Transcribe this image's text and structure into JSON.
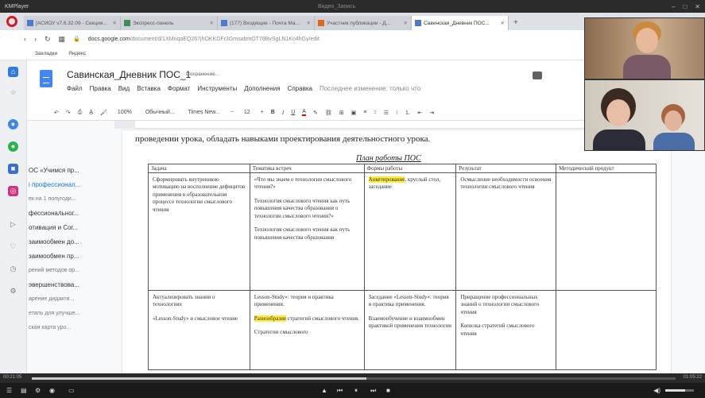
{
  "player": {
    "title": "KMPlayer",
    "window_title": "Видео_Запись",
    "time_elapsed": "00:21:05",
    "time_total": "01:05:22",
    "progress": 0.52,
    "volume": 0.7
  },
  "browser": {
    "tabs": [
      {
        "label": "[АСИОУ v7.6.32.09 - Секция..."
      },
      {
        "label": "Экспресс-панель"
      },
      {
        "label": "(177) Входящие - Почта Ма..."
      },
      {
        "label": "Участник публикации - Д..."
      },
      {
        "label": "Савинская_Дневник ПОС..."
      }
    ],
    "url_host": "docs.google.com",
    "url_path": "/document/d/1XMnqaEQ267jhOKKDFr3GmsabmOT78BvSgLN1Ko4hGy/edit",
    "bookmarks": [
      "Закладки",
      "Яндекс"
    ]
  },
  "doc": {
    "title": "Савинская_Дневник ПОС_1",
    "saving": "Сохранение...",
    "menu": [
      "Файл",
      "Правка",
      "Вид",
      "Вставка",
      "Формат",
      "Инструменты",
      "Дополнения",
      "Справка"
    ],
    "last_edit": "Последнее изменение: только что",
    "toolbar": {
      "zoom": "100%",
      "style": "Обычный...",
      "font": "Times New...",
      "size": "12"
    },
    "body_text": "проведении урока, обладать навыками проектирования деятельностного урока.",
    "plan_title": "План работы ПОС",
    "table": {
      "headers": [
        "Задача",
        "Тематика встреч",
        "Формы работы",
        "Результат",
        "Методический продукт"
      ],
      "row1": {
        "task": "Сформировать внутреннюю мотивацию на восполнение дефицитов применения в образовательном процессе технологии смыслового чтения",
        "topics": [
          "«Что мы знаем о технологии смыслового чтения?»",
          "Технология смыслового чтения как путь повышения качества образования о технологии смыслового чтения?»",
          "Технология смыслового чтения как путь повышения качества образования"
        ],
        "forms_highlight": "Анкетирование",
        "forms_rest": "круглый стол, заседание",
        "result": "Осмысление необходимости освоения технологии смыслового чтения",
        "product": ""
      },
      "row2": {
        "task1": "Актуализировать знания о технологиях",
        "task2": "«Lesson-Study» и смысловое чтение",
        "topic1": "Lesson-Study»: теория и практика применения.",
        "topic2_highlight": "Разнообразие",
        "topic2_rest": "стратегий смыслового чтения.",
        "topic3": "Стратегии смыслового",
        "forms1": "Заседание «Lesson-Study»: теория и практика применения.",
        "forms2": "Взаимообучение и взаимообмен практикой применения технологии",
        "result1": "Приращение профессиональных знаний о технологии смыслового чтения",
        "result2": "Копилка стратегий смыслового чтения",
        "product": ""
      }
    },
    "outline": [
      "ОС «Учимся пр...",
      "і профессионал...",
      "ек на 1 полугоди...",
      "фессиональног...",
      "отивация и Сог...",
      "заимообмен до...",
      "заимообмен пр...",
      "рений методов ор...",
      "эвершенствова...",
      "арение дидакти...",
      "еталь для улучше...",
      "ская карта уро..."
    ]
  }
}
